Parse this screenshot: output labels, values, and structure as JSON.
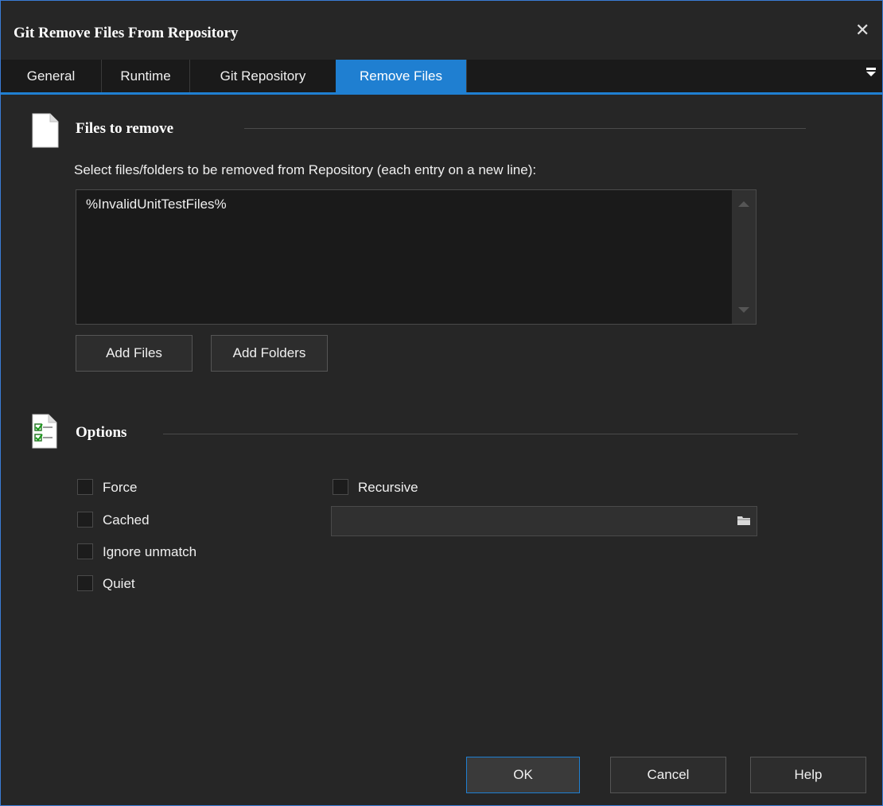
{
  "window": {
    "title": "Git Remove Files From Repository",
    "close_glyph": "✕"
  },
  "tabs": [
    {
      "label": "General"
    },
    {
      "label": "Runtime"
    },
    {
      "label": "Git Repository"
    },
    {
      "label": "Remove Files",
      "active": true
    }
  ],
  "files_section": {
    "title": "Files to remove",
    "instruction": "Select files/folders to be removed from Repository (each entry on a new line):",
    "files_value": "%InvalidUnitTestFiles%",
    "add_files_label": "Add Files",
    "add_folders_label": "Add Folders",
    "icon": "document-icon"
  },
  "options_section": {
    "title": "Options",
    "icon": "checklist-icon",
    "force_label": "Force",
    "cached_label": "Cached",
    "ignore_unmatch_label": "Ignore unmatch",
    "quiet_label": "Quiet",
    "recursive_label": "Recursive",
    "path_value": ""
  },
  "footer": {
    "ok_label": "OK",
    "cancel_label": "Cancel",
    "help_label": "Help"
  },
  "colors": {
    "accent": "#1f7fd1",
    "background": "#262626"
  }
}
